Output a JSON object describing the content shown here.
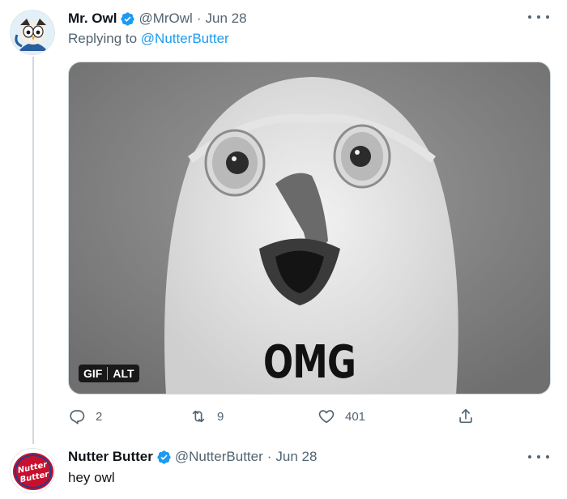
{
  "tweet": {
    "name": "Mr. Owl",
    "handle": "@MrOwl",
    "date": "Jun 28",
    "replying_prefix": "Replying to",
    "replying_to": "@NutterButter",
    "media": {
      "badge_gif": "GIF",
      "badge_alt": "ALT",
      "caption": "OMG"
    },
    "stats": {
      "replies": "2",
      "retweets": "9",
      "likes": "401"
    }
  },
  "reply": {
    "name": "Nutter Butter",
    "handle": "@NutterButter",
    "date": "Jun 28",
    "text": "hey owl",
    "avatar_text_1": "Nutter",
    "avatar_text_2": "Butter"
  },
  "separator": "·",
  "colors": {
    "accent": "#1d9bf0",
    "muted": "#536471",
    "text": "#0f1419",
    "brand_red": "#c8102e"
  },
  "icons": {
    "verified": "verified-badge-icon",
    "reply": "reply-icon",
    "retweet": "retweet-icon",
    "like": "heart-icon",
    "share": "share-icon",
    "more": "more-dots-icon"
  }
}
